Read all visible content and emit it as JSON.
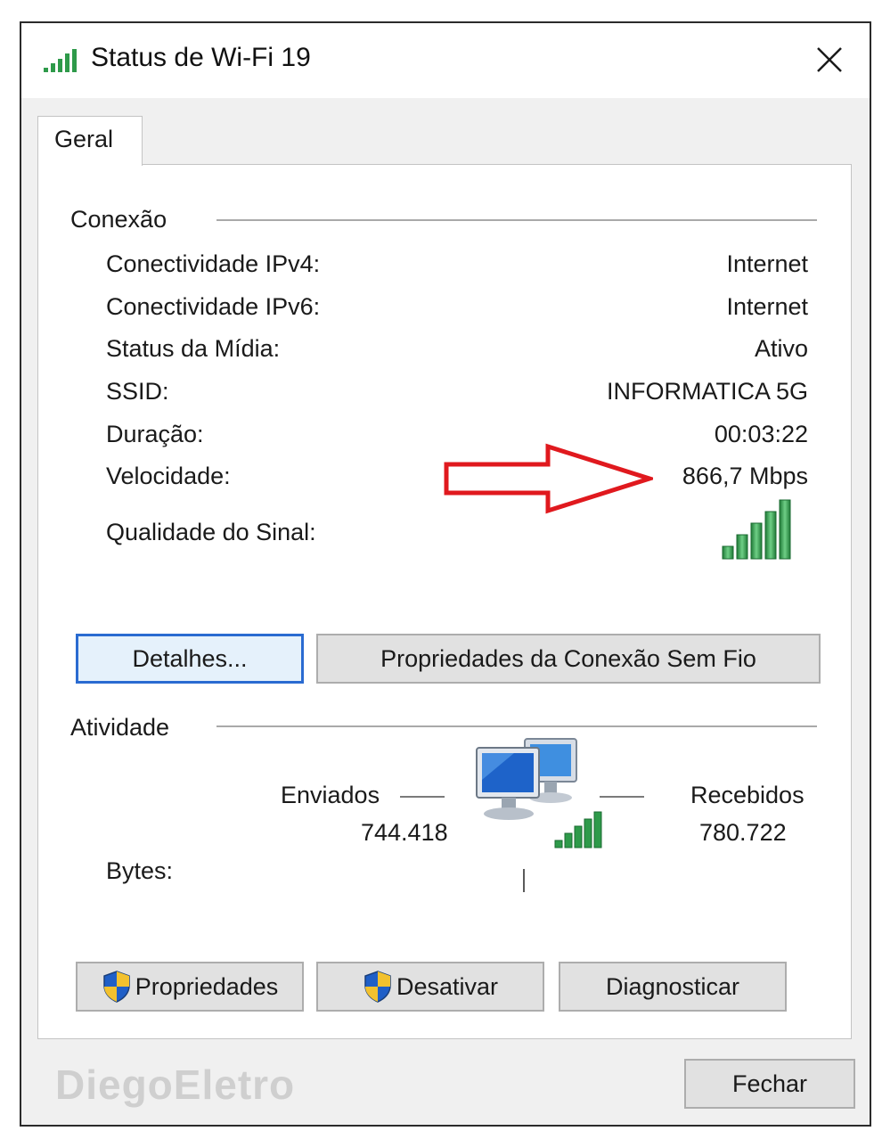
{
  "window": {
    "title": "Status de Wi-Fi 19",
    "title_icon": "wifi-signal-icon",
    "close_icon": "close-icon"
  },
  "tabs": [
    {
      "label": "Geral",
      "selected": true
    }
  ],
  "conexao": {
    "title": "Conexão",
    "rows": [
      {
        "label": "Conectividade IPv4:",
        "value": "Internet"
      },
      {
        "label": "Conectividade IPv6:",
        "value": "Internet"
      },
      {
        "label": "Status da Mídia:",
        "value": "Ativo"
      },
      {
        "label": "SSID:",
        "value": "INFORMATICA 5G"
      },
      {
        "label": "Duração:",
        "value": "00:03:22"
      },
      {
        "label": "Velocidade:",
        "value": "866,7 Mbps"
      }
    ],
    "signal_label": "Qualidade do Sinal:",
    "signal_bars": 5,
    "signal_max": 5
  },
  "buttons": {
    "details": "Detalhes...",
    "wireless_properties": "Propriedades da Conexão Sem Fio",
    "properties": "Propriedades",
    "disable": "Desativar",
    "diagnose": "Diagnosticar",
    "close": "Fechar"
  },
  "atividade": {
    "title": "Atividade",
    "sent_label": "Enviados",
    "received_label": "Recebidos",
    "bytes_label": "Bytes:",
    "bytes_sent": "744.418",
    "bytes_received": "780.722"
  },
  "watermark": "DiegoEletro",
  "colors": {
    "signal_green": "#2e9a4a",
    "annotation_arrow": "#e0191e",
    "focus_blue": "#2a6bd1"
  }
}
